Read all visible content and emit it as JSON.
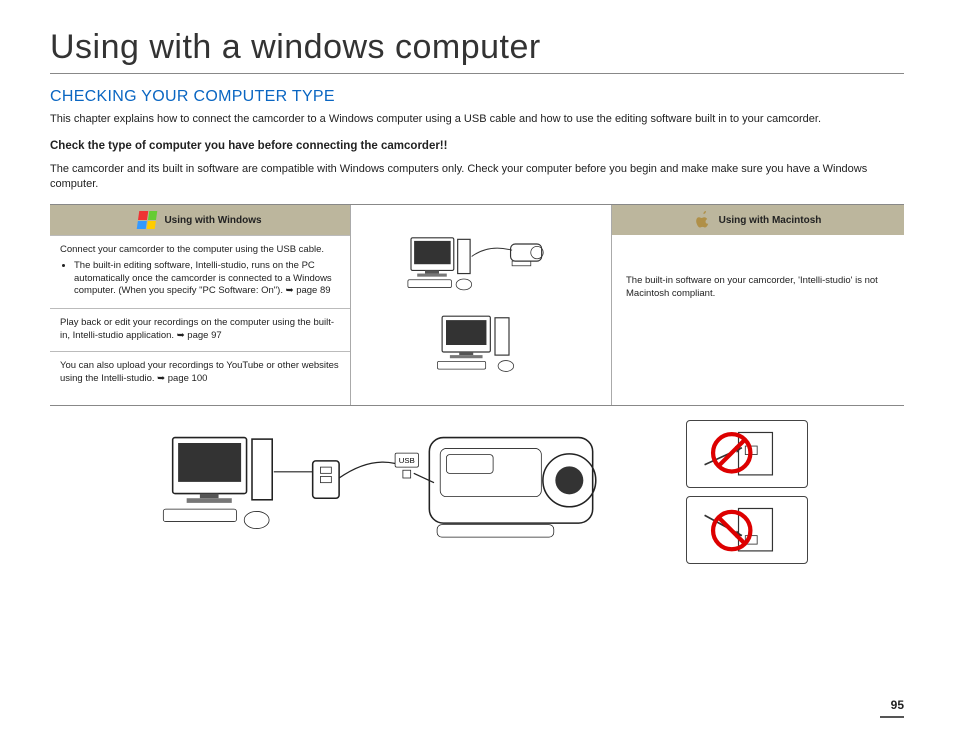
{
  "page_title": "Using with a windows computer",
  "section_title": "CHECKING YOUR COMPUTER TYPE",
  "intro": "This chapter explains how to connect the camcorder to a Windows computer using a USB cable and how to use the editing software built in to your camcorder.",
  "bold_lead": "Check the type of computer you have before connecting the camcorder!!",
  "lead_para": "The camcorder and its built in software are compatible with Windows computers only. Check your computer before you begin and make make sure you have a Windows computer.",
  "windows": {
    "bar_label": "Using with Windows",
    "cell1_intro": "Connect your camcorder to the computer using the USB cable.",
    "cell1_bullet": "The built-in editing software, Intelli-studio, runs on the PC automatically once the camcorder is connected to a Windows computer. (When you specify \"PC Software: On\"). ➥ page 89",
    "cell2": "Play back or edit your recordings on the computer using the built-in, Intelli-studio application. ➥ page 97",
    "cell3": "You can also upload your recordings to YouTube or other websites using the Intelli-studio. ➥ page 100"
  },
  "mac": {
    "bar_label": "Using with Macintosh",
    "cell": "The built-in software on your camcorder, 'Intelli-studio' is not Macintosh compliant."
  },
  "usb_label": "USB",
  "page_number": "95"
}
